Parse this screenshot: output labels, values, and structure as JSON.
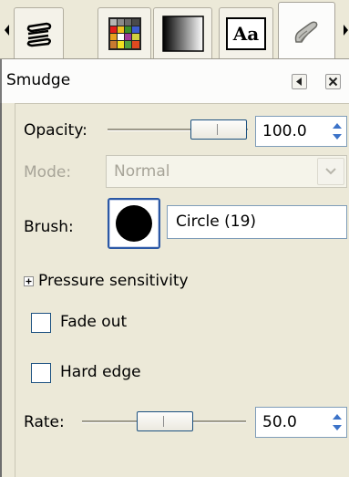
{
  "tabs": [
    {
      "icon": "device-status-icon",
      "active": false
    },
    {
      "icon": "palettes-grid-icon",
      "active": false
    },
    {
      "icon": "gradient-icon",
      "active": false
    },
    {
      "icon": "fonts-icon",
      "label": "Aa",
      "active": false
    },
    {
      "icon": "smudge-tool-icon",
      "active": true
    }
  ],
  "dock": {
    "title": "Smudge",
    "menu_icon": "tab-menu-icon",
    "close_icon": "close-icon"
  },
  "options": {
    "opacity": {
      "label": "Opacity:",
      "value": "100.0",
      "fraction": 1.0
    },
    "mode": {
      "label": "Mode:",
      "value": "Normal",
      "enabled": false
    },
    "brush": {
      "label": "Brush:",
      "name": "Circle (19)"
    },
    "pressure": {
      "label": "Pressure sensitivity",
      "expanded": false
    },
    "fade_out": {
      "label": "Fade out",
      "checked": false
    },
    "hard_edge": {
      "label": "Hard edge",
      "checked": false
    },
    "rate": {
      "label": "Rate:",
      "value": "50.0",
      "fraction": 0.5
    }
  },
  "colors": {
    "background": "#ece9d8",
    "focus_blue": "#2b58a5",
    "border_blue": "#7f9db9"
  }
}
